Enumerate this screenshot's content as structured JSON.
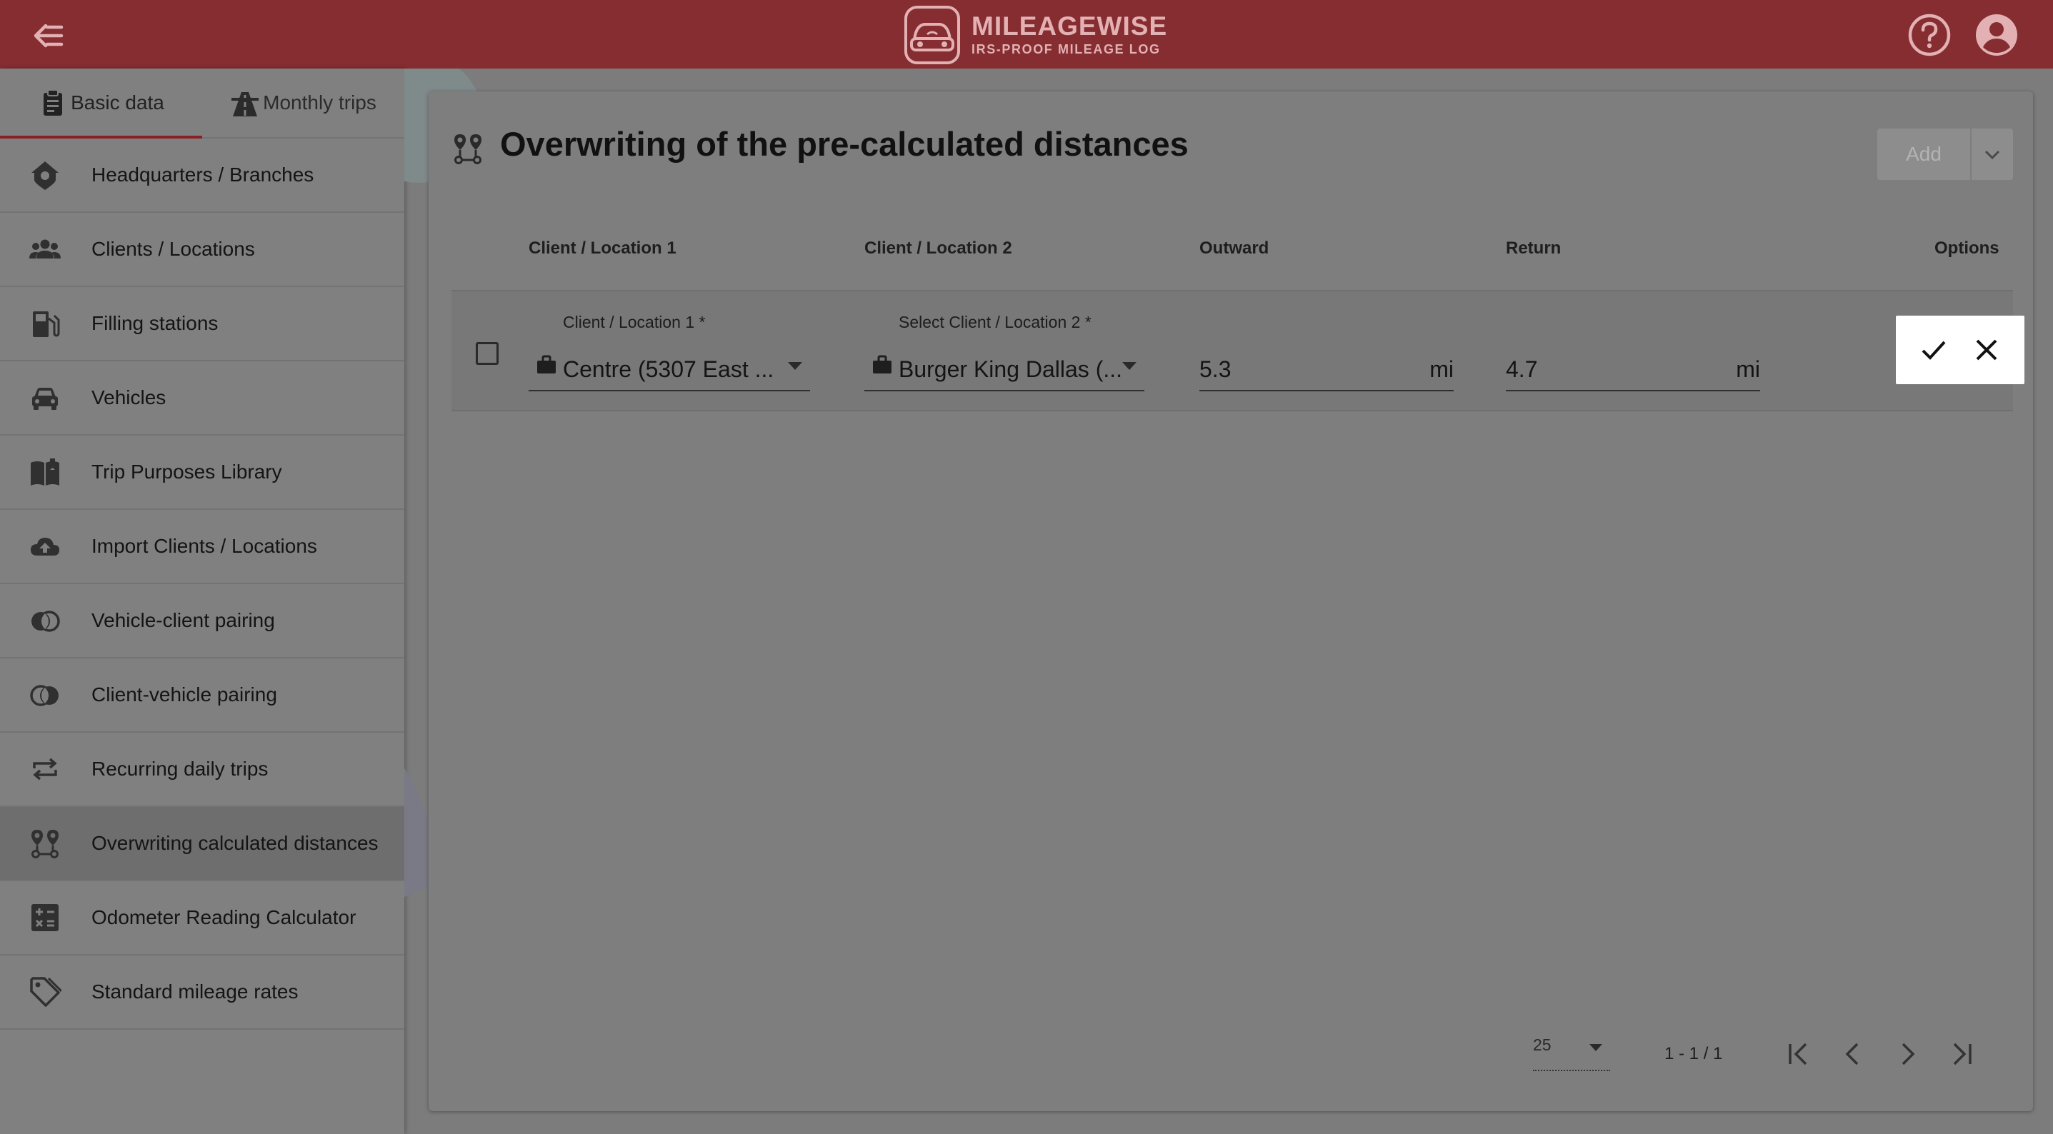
{
  "header": {
    "brand_name": "MILEAGEWISE",
    "brand_tagline": "IRS-PROOF MILEAGE LOG"
  },
  "sidebar": {
    "tabs": [
      {
        "label": "Basic data",
        "icon": "clipboard-icon",
        "active": true
      },
      {
        "label": "Monthly trips",
        "icon": "road-icon",
        "active": false
      }
    ],
    "items": [
      {
        "label": "Headquarters / Branches",
        "icon": "home-pin-icon"
      },
      {
        "label": "Clients / Locations",
        "icon": "people-icon"
      },
      {
        "label": "Filling stations",
        "icon": "fuel-pump-icon"
      },
      {
        "label": "Vehicles",
        "icon": "car-icon"
      },
      {
        "label": "Trip Purposes Library",
        "icon": "book-icon"
      },
      {
        "label": "Import Clients / Locations",
        "icon": "cloud-upload-icon"
      },
      {
        "label": "Vehicle-client pairing",
        "icon": "pairing-icon"
      },
      {
        "label": "Client-vehicle pairing",
        "icon": "pairing-icon"
      },
      {
        "label": "Recurring daily trips",
        "icon": "repeat-icon"
      },
      {
        "label": "Overwriting calculated distances",
        "icon": "route-pins-icon",
        "active": true
      },
      {
        "label": "Odometer Reading Calculator",
        "icon": "calculator-icon"
      },
      {
        "label": "Standard mileage rates",
        "icon": "tags-icon"
      }
    ]
  },
  "main": {
    "title": "Overwriting of the pre-calculated distances",
    "add_label": "Add",
    "columns": {
      "loc1": "Client / Location 1",
      "loc2": "Client / Location 2",
      "outward": "Outward",
      "return": "Return",
      "options": "Options"
    },
    "row": {
      "loc1_label": "Client / Location 1 *",
      "loc1_value": "Centre (5307 East ...",
      "loc2_label": "Select Client / Location 2 *",
      "loc2_value": "Burger King Dallas (...",
      "outward_value": "5.3",
      "outward_unit": "mi",
      "return_value": "4.7",
      "return_unit": "mi"
    },
    "pagination": {
      "per_page": "25",
      "range": "1 - 1 / 1"
    }
  },
  "colors": {
    "header_bg": "#852d31",
    "accent": "#8a1f24",
    "brand_text": "#e3b1b3"
  }
}
